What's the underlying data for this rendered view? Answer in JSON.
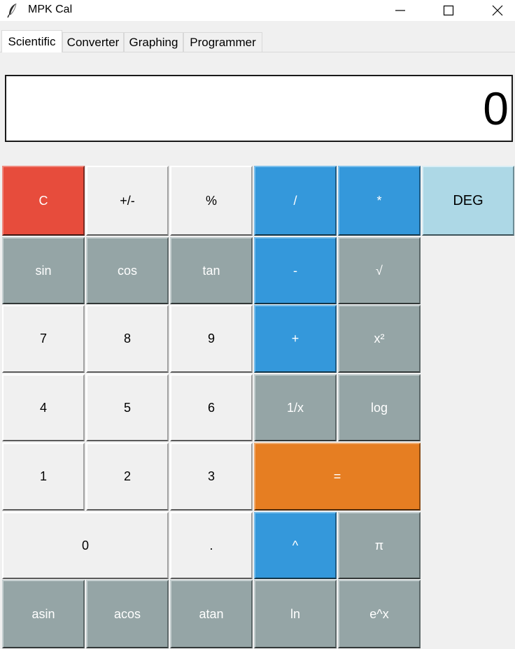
{
  "window": {
    "title": "MPK Cal",
    "icon": "feather-icon"
  },
  "tabs": [
    {
      "label": "Scientific",
      "active": true
    },
    {
      "label": "Converter",
      "active": false
    },
    {
      "label": "Graphing",
      "active": false
    },
    {
      "label": "Programmer",
      "active": false
    }
  ],
  "display": {
    "value": "0"
  },
  "colors": {
    "clear": "#e74c3c",
    "operator": "#3498db",
    "function": "#95a5a6",
    "equals": "#e67e22",
    "mode": "#add8e6",
    "digit": "#f0f0f0"
  },
  "buttons": {
    "clear": "C",
    "negate": "+/-",
    "percent": "%",
    "divide": "/",
    "multiply": "*",
    "angle_mode": "DEG",
    "sin": "sin",
    "cos": "cos",
    "tan": "tan",
    "subtract": "-",
    "sqrt": "√",
    "seven": "7",
    "eight": "8",
    "nine": "9",
    "add": "+",
    "square": "x²",
    "four": "4",
    "five": "5",
    "six": "6",
    "reciprocal": "1/x",
    "log": "log",
    "one": "1",
    "two": "2",
    "three": "3",
    "equals": "=",
    "zero": "0",
    "decimal": ".",
    "power": "^",
    "pi": "π",
    "asin": "asin",
    "acos": "acos",
    "atan": "atan",
    "ln": "ln",
    "exp": "e^x"
  }
}
